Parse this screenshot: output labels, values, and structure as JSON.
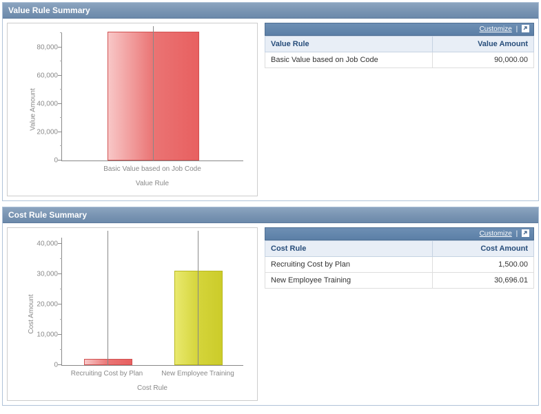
{
  "sections": [
    {
      "id": "value",
      "title": "Value Rule Summary",
      "table": {
        "customize_label": "Customize",
        "headers": {
          "rule": "Value Rule",
          "amount": "Value Amount"
        },
        "rows": [
          {
            "rule": "Basic Value based on Job Code",
            "amount": "90,000.00"
          }
        ]
      },
      "chart_data": {
        "type": "bar",
        "categories": [
          "Basic Value based on Job Code"
        ],
        "values": [
          90000
        ],
        "ylabel": "Value Amount",
        "xlabel": "Value Rule",
        "ylim": [
          0,
          90000
        ],
        "yticks": [
          0,
          20000,
          40000,
          60000,
          80000
        ],
        "ytick_labels": [
          "0",
          "20,000",
          "40,000",
          "60,000",
          "80,000"
        ],
        "colors": [
          "red"
        ]
      }
    },
    {
      "id": "cost",
      "title": "Cost Rule Summary",
      "table": {
        "customize_label": "Customize",
        "headers": {
          "rule": "Cost Rule",
          "amount": "Cost Amount"
        },
        "rows": [
          {
            "rule": "Recruiting Cost by Plan",
            "amount": "1,500.00"
          },
          {
            "rule": "New Employee Training",
            "amount": "30,696.01"
          }
        ]
      },
      "chart_data": {
        "type": "bar",
        "categories": [
          "Recruiting Cost by Plan",
          "New Employee Training"
        ],
        "values": [
          1500,
          30696.01
        ],
        "ylabel": "Cost Amount",
        "xlabel": "Cost Rule",
        "ylim": [
          0,
          42000
        ],
        "yticks": [
          0,
          10000,
          20000,
          30000,
          40000
        ],
        "ytick_labels": [
          "0",
          "10,000",
          "20,000",
          "30,000",
          "40,000"
        ],
        "colors": [
          "red",
          "yellow"
        ]
      }
    }
  ]
}
